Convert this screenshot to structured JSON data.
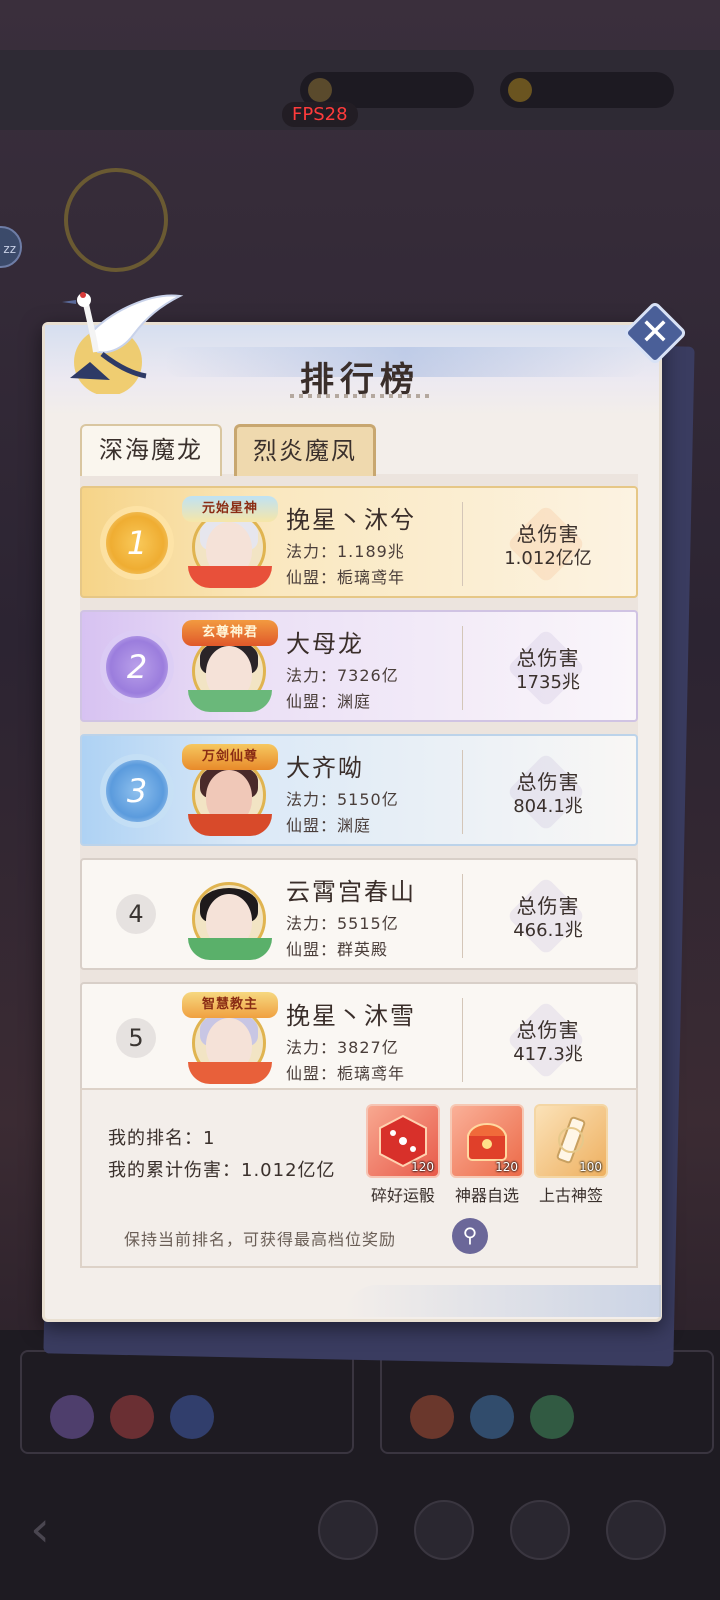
{
  "hud": {
    "fps": "FPS28"
  },
  "panel": {
    "title": "排行榜",
    "close_icon": "close-icon",
    "tabs": [
      {
        "label": "深海魔龙",
        "active": false
      },
      {
        "label": "烈炎魔凤",
        "active": true
      }
    ]
  },
  "rankings": [
    {
      "rank": "1",
      "avatar_title": "元始星神",
      "name": "挽星丶沐兮",
      "power": "法力：1.189兆",
      "guild": "仙盟：栀璃鸢年",
      "damage_label": "总伤害",
      "damage": "1.012亿亿"
    },
    {
      "rank": "2",
      "avatar_title": "玄尊神君",
      "name": "大母龙",
      "power": "法力：7326亿",
      "guild": "仙盟：渊庭",
      "damage_label": "总伤害",
      "damage": "1735兆"
    },
    {
      "rank": "3",
      "avatar_title": "万剑仙尊",
      "name": "大齐呦",
      "power": "法力：5150亿",
      "guild": "仙盟：渊庭",
      "damage_label": "总伤害",
      "damage": "804.1兆"
    },
    {
      "rank": "4",
      "avatar_title": "",
      "name": "云霄宫春山",
      "power": "法力：5515亿",
      "guild": "仙盟：群英殿",
      "damage_label": "总伤害",
      "damage": "466.1兆"
    },
    {
      "rank": "5",
      "avatar_title": "智慧教主",
      "name": "挽星丶沐雪",
      "power": "法力：3827亿",
      "guild": "仙盟：栀璃鸢年",
      "damage_label": "总伤害",
      "damage": "417.3兆"
    }
  ],
  "footer": {
    "my_rank": "我的排名：1",
    "my_damage": "我的累计伤害：1.012亿亿",
    "hint": "保持当前排名，可获得最高档位奖励",
    "search_icon": "search-icon",
    "rewards": [
      {
        "label": "碎好运骰",
        "count": "120",
        "color": "#f07a5a"
      },
      {
        "label": "神器自选",
        "count": "120",
        "color": "#f2805a"
      },
      {
        "label": "上古神签",
        "count": "100",
        "color": "#f2c88a"
      }
    ]
  }
}
